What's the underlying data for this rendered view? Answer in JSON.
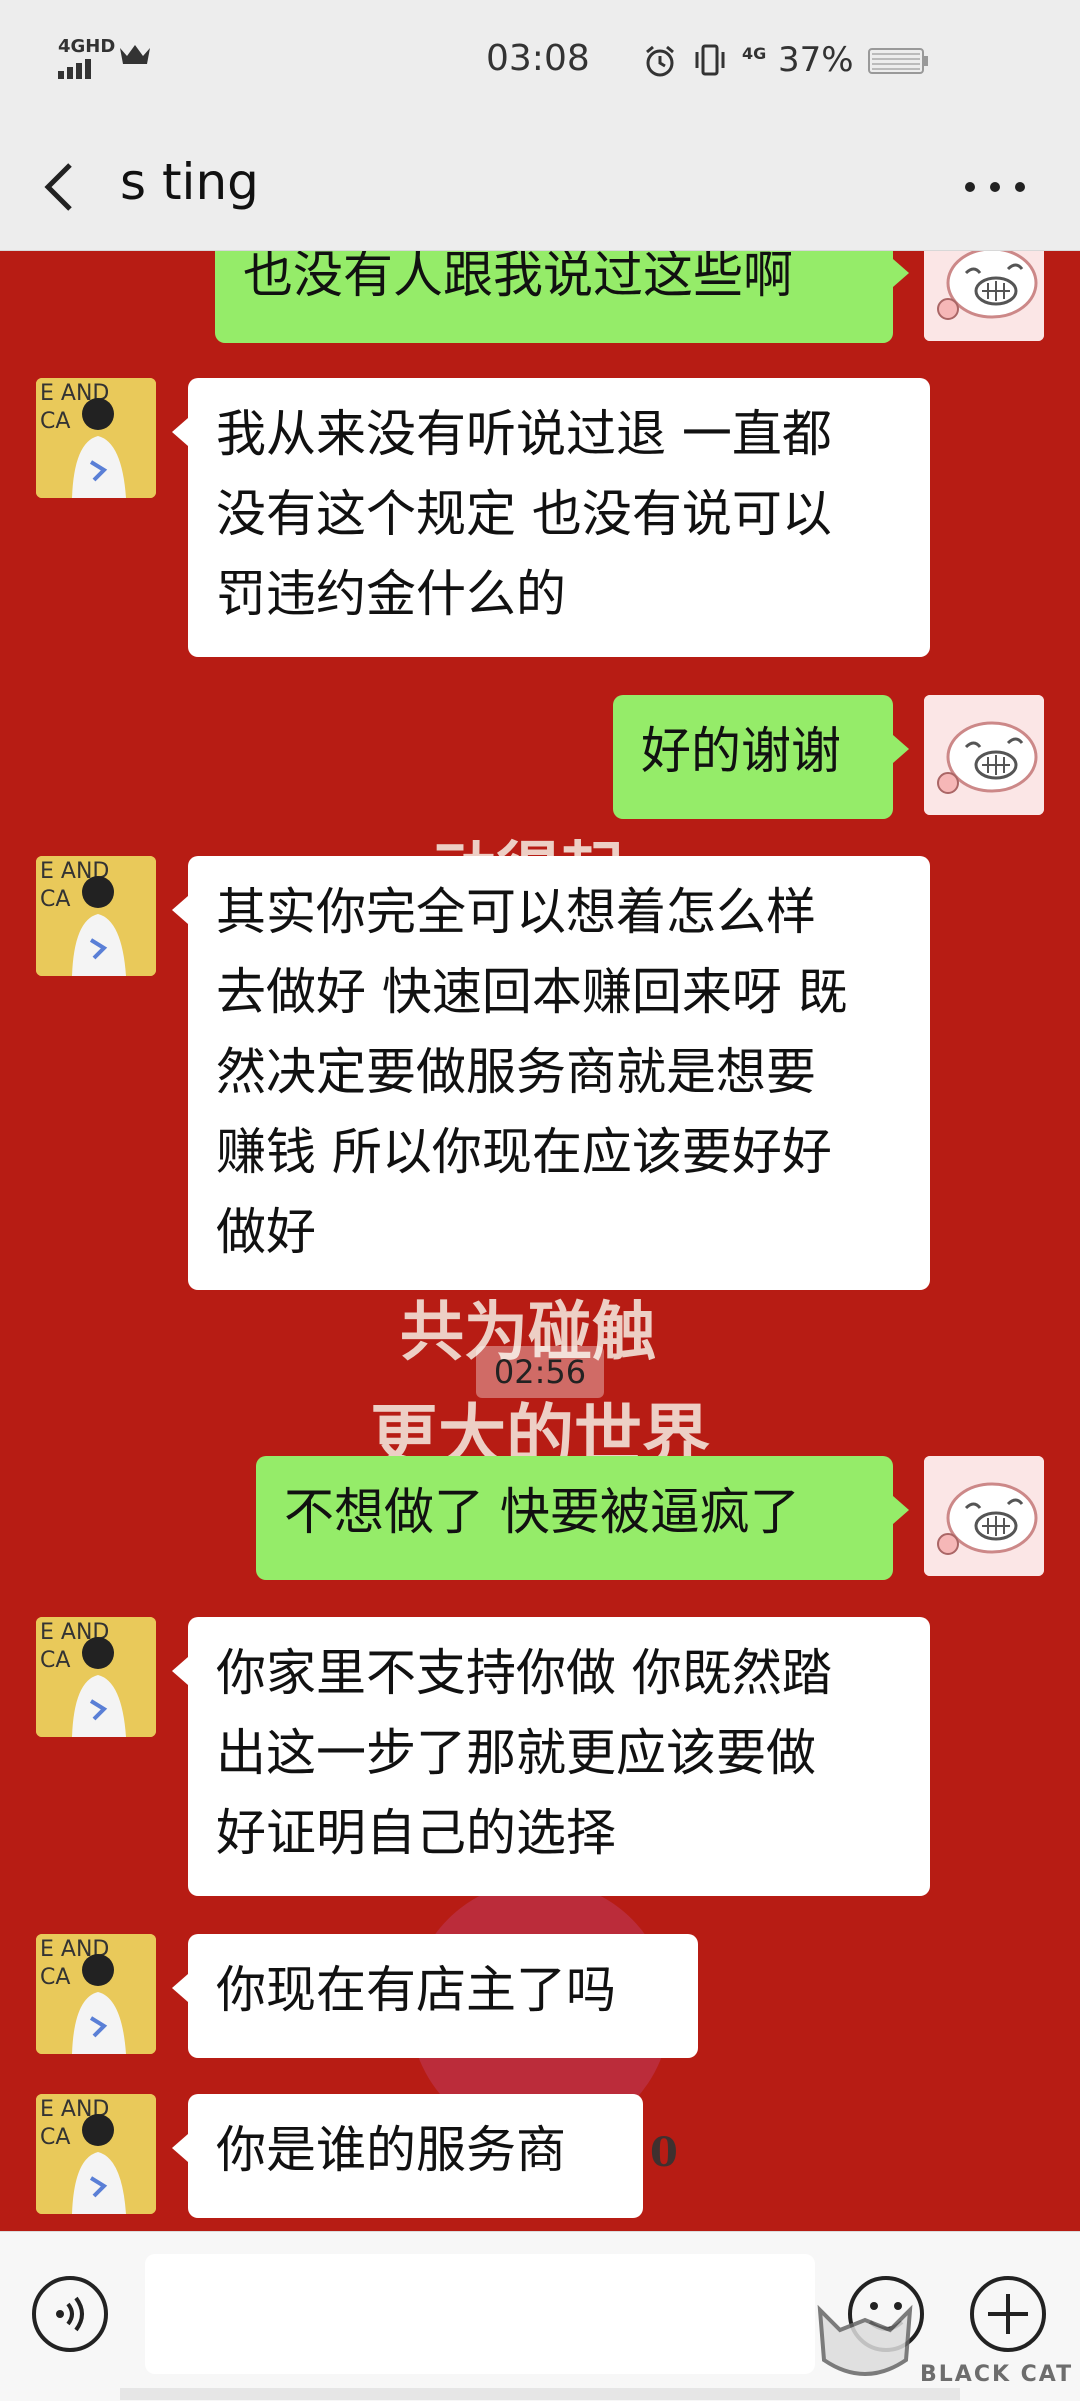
{
  "status_bar": {
    "network": "4GHD",
    "time": "03:08",
    "data_type": "4G",
    "battery": "37%",
    "icons": [
      "signal-icon",
      "crown-icon",
      "alarm-icon",
      "vibrate-icon",
      "battery-icon"
    ]
  },
  "header": {
    "title": "s ting",
    "back_icon": "chevron-left-icon",
    "more_icon": "more-dots-icon"
  },
  "background_text": {
    "line1": "动得起",
    "line2": "共为碰触",
    "line3": "更大的世界",
    "stray": "0"
  },
  "messages": [
    {
      "side": "me",
      "text": "也没有人跟我说过这些啊"
    },
    {
      "side": "friend",
      "lines": [
        "我从来没有听说过退 一直都",
        "没有这个规定 也没有说可以",
        "罚违约金什么的"
      ]
    },
    {
      "side": "me",
      "text": "好的谢谢"
    },
    {
      "side": "friend",
      "lines": [
        "其实你完全可以想着怎么样",
        "去做好 快速回本赚回来呀 既",
        "然决定要做服务商就是想要",
        "赚钱 所以你现在应该要好好",
        "做好"
      ]
    },
    {
      "side": "me",
      "text": "不想做了 快要被逼疯了"
    },
    {
      "side": "friend",
      "lines": [
        "你家里不支持你做 你既然踏",
        "出这一步了那就更应该要做",
        "好证明自己的选择"
      ]
    },
    {
      "side": "friend",
      "text": "你现在有店主了吗"
    },
    {
      "side": "friend",
      "text": "你是谁的服务商"
    }
  ],
  "timestamp": "02:56",
  "input_bar": {
    "voice_icon": "voice-icon",
    "emoji_icon": "emoji-icon",
    "plus_icon": "plus-icon"
  },
  "watermark": {
    "text": "BLACK CAT"
  },
  "colors": {
    "chat_bg": "#b71c14",
    "my_bubble": "#95ec69",
    "friend_bubble": "#ffffff",
    "bar_bg": "#ededed"
  }
}
